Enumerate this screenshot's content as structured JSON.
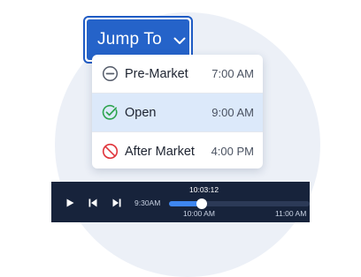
{
  "jump": {
    "label": "Jump To"
  },
  "menu": {
    "items": [
      {
        "label": "Pre-Market",
        "time": "7:00 AM",
        "icon": "minus-circle-icon",
        "selected": false
      },
      {
        "label": "Open",
        "time": "9:00 AM",
        "icon": "check-circle-icon",
        "selected": true
      },
      {
        "label": "After Market",
        "time": "4:00 PM",
        "icon": "prohibited-icon",
        "selected": false
      }
    ]
  },
  "player": {
    "current_time": "10:03:12",
    "start_label": "9:30AM",
    "tick_labels": [
      "10:00 AM",
      "11:00 AM"
    ],
    "progress_fraction": 0.23,
    "colors": {
      "bar": "#17233b",
      "progress": "#3e86f0"
    }
  },
  "colors": {
    "accent": "#2563c9",
    "selected_row": "#dce9fa",
    "check": "#2ea44f",
    "prohibited": "#e0353b"
  }
}
